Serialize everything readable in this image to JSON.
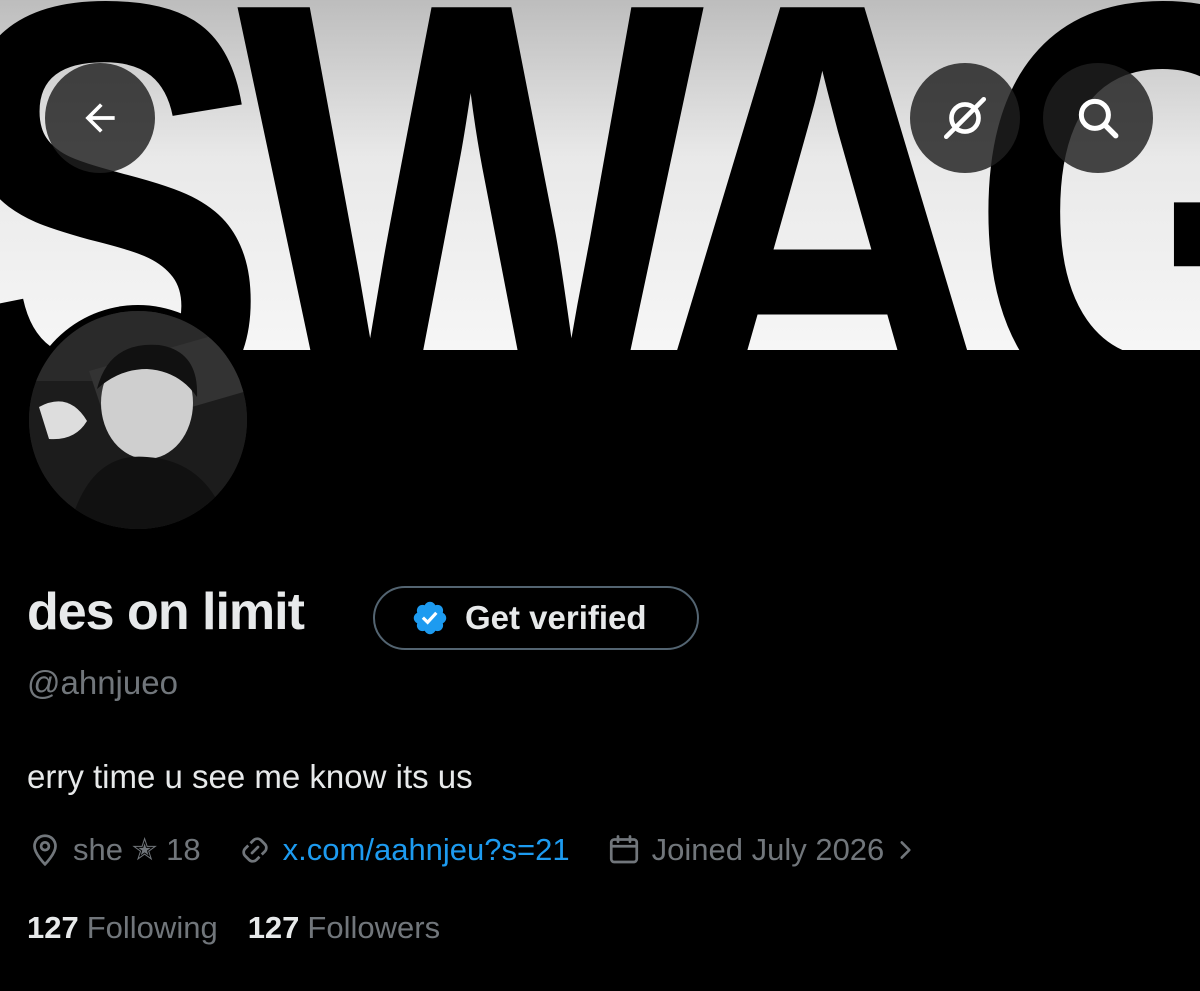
{
  "banner": {
    "text": "SWAG"
  },
  "header": {
    "back_icon": "arrow-left-icon",
    "grok_icon": "grok-icon",
    "search_icon": "search-icon"
  },
  "profile": {
    "display_name": "des on limit",
    "verify_label": "Get verified",
    "verify_badge_color": "#1d9bf0",
    "handle": "@ahnjueo",
    "bio": "erry time u see me know its us",
    "location": "she ✭ 18",
    "link": "x.com/aahnjeu?s=21",
    "joined": "Joined July 2026"
  },
  "stats": {
    "following_count": "127",
    "following_label": "Following",
    "followers_count": "127",
    "followers_label": "Followers"
  },
  "colors": {
    "background": "#000000",
    "text_primary": "#e7e9ea",
    "text_secondary": "#71767b",
    "link": "#1d9bf0"
  }
}
